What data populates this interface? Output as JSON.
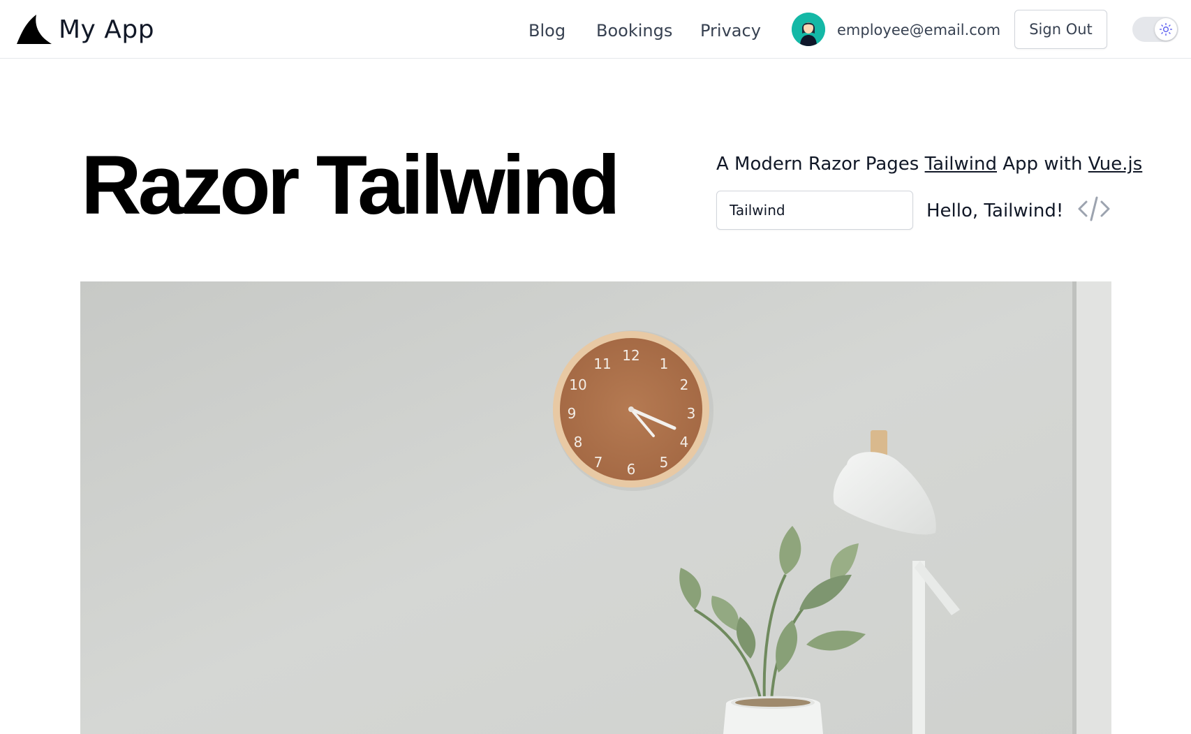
{
  "app": {
    "brand_name": "My App"
  },
  "nav": {
    "links": [
      {
        "label": "Blog"
      },
      {
        "label": "Bookings"
      },
      {
        "label": "Privacy"
      }
    ],
    "user_email": "employee@email.com",
    "sign_out_label": "Sign Out",
    "theme_toggle_icon": "sun-icon"
  },
  "hero": {
    "title": "Razor Tailwind",
    "tagline_prefix": "A Modern Razor Pages ",
    "tagline_link1": "Tailwind",
    "tagline_middle": " App with ",
    "tagline_link2": "Vue.js",
    "input_value": "Tailwind",
    "greeting": "Hello, Tailwind!",
    "code_icon": "code-icon"
  },
  "image": {
    "subject": "clock-plant-lamp-photo"
  },
  "colors": {
    "avatar_bg": "#14b8a6",
    "text": "#111827",
    "nav_text": "#374151",
    "border": "#d1d5db",
    "toggle_bg": "#e5e7eb",
    "sun_icon": "#6366f1"
  }
}
